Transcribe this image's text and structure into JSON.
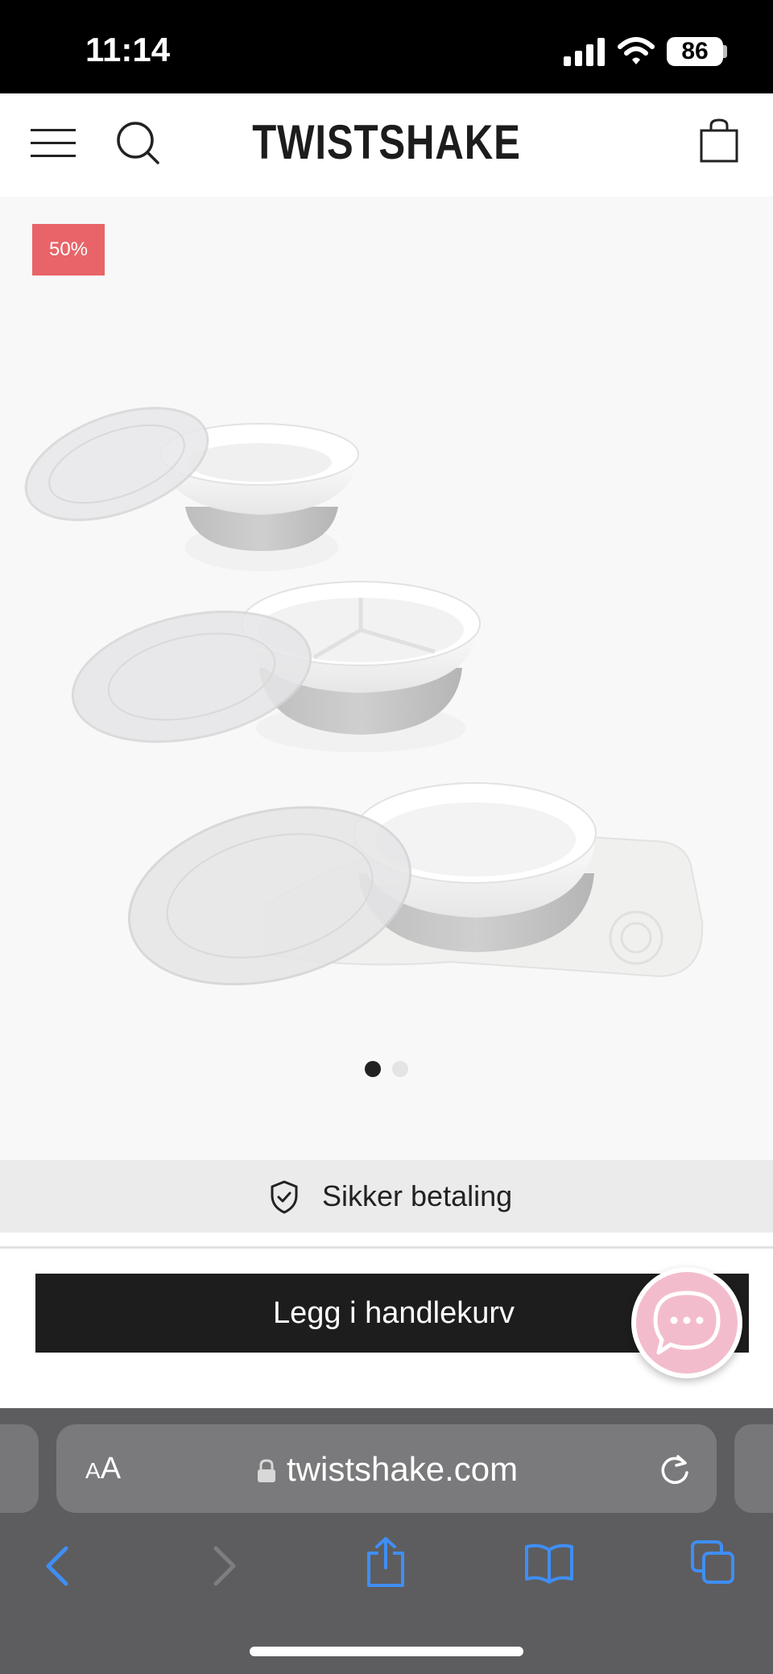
{
  "status_bar": {
    "time": "11:14",
    "battery": "86"
  },
  "header": {
    "brand": "TWISTSHAKE"
  },
  "product": {
    "discount_badge": "50%",
    "image_dots": {
      "count": 2,
      "active_index": 0
    }
  },
  "secure_payment": {
    "label": "Sikker betaling"
  },
  "cart": {
    "button_label": "Legg i handlekurv"
  },
  "browser": {
    "text_size_small": "A",
    "text_size_large": "A",
    "url": "twistshake.com"
  },
  "colors": {
    "badge": "#e86468",
    "cart_button": "#1d1d1d",
    "chat_bubble": "#f3bccc",
    "browser_icons": "#3f8ef5"
  },
  "icons": [
    "signal-icon",
    "wifi-icon",
    "battery-icon",
    "menu-icon",
    "search-icon",
    "cart-icon",
    "shield-check-icon",
    "chat-icon",
    "lock-icon",
    "reload-icon",
    "back-icon",
    "forward-icon",
    "share-icon",
    "bookmarks-icon",
    "tabs-icon"
  ]
}
